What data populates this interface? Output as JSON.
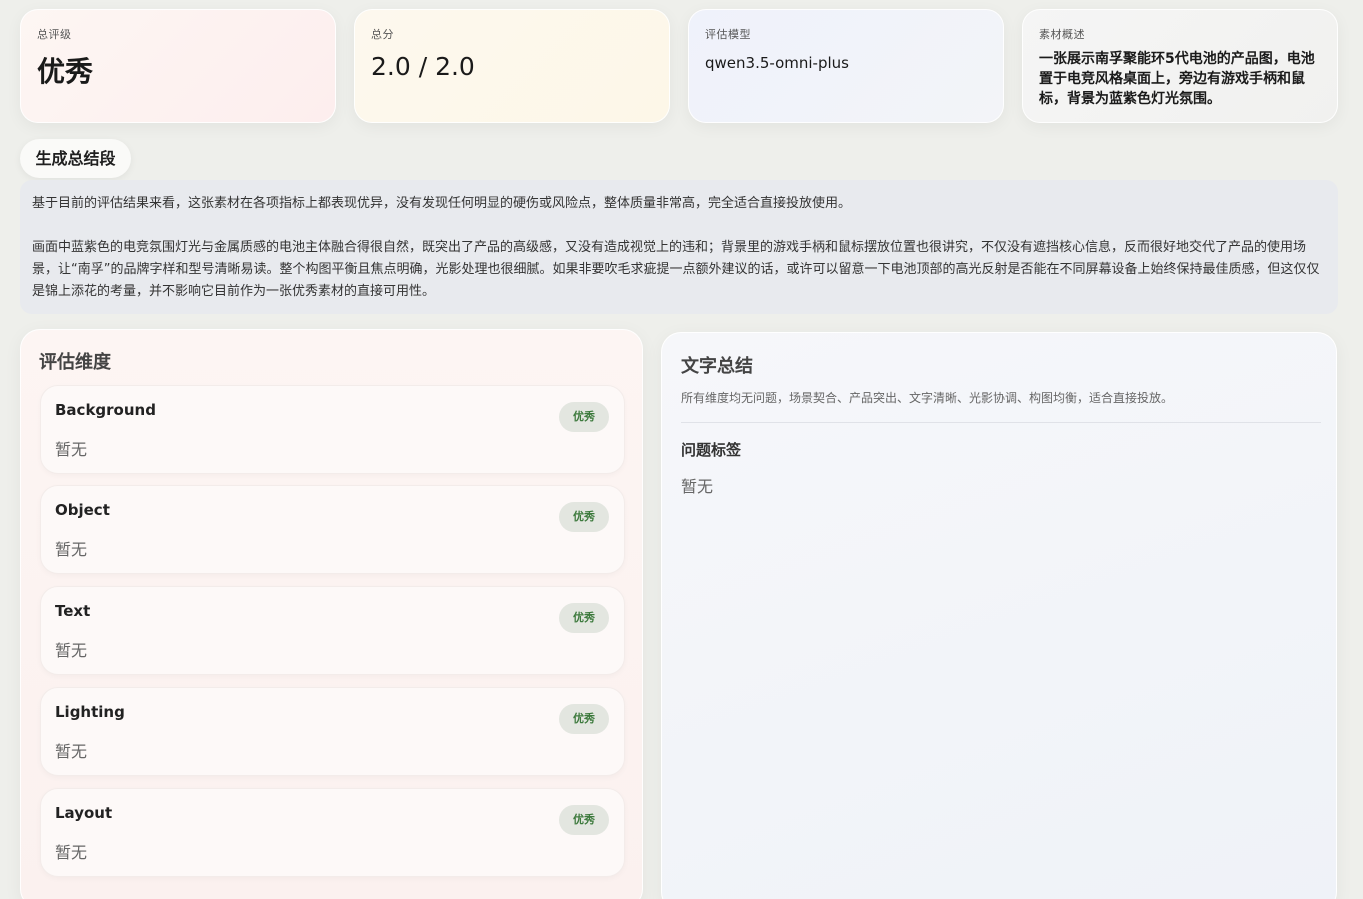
{
  "top_cards": {
    "grade": {
      "label": "总评级",
      "value": "优秀"
    },
    "score": {
      "label": "总分",
      "value": "2.0 / 2.0"
    },
    "model": {
      "label": "评估模型",
      "value": "qwen3.5-omni-plus"
    },
    "description": {
      "label": "素材概述",
      "value": "一张展示南孚聚能环5代电池的产品图，电池置于电竞风格桌面上，旁边有游戏手柄和鼠标，背景为蓝紫色灯光氛围。"
    }
  },
  "summary": {
    "title": "生成总结段",
    "paragraph1": "基于目前的评估结果来看，这张素材在各项指标上都表现优异，没有发现任何明显的硬伤或风险点，整体质量非常高，完全适合直接投放使用。",
    "paragraph2": "画面中蓝紫色的电竞氛围灯光与金属质感的电池主体融合得很自然，既突出了产品的高级感，又没有造成视觉上的违和；背景里的游戏手柄和鼠标摆放位置也很讲究，不仅没有遮挡核心信息，反而很好地交代了产品的使用场景，让“南孚”的品牌字样和型号清晰易读。整个构图平衡且焦点明确，光影处理也很细腻。如果非要吹毛求疵提一点额外建议的话，或许可以留意一下电池顶部的高光反射是否能在不同屏幕设备上始终保持最佳质感，但这仅仅是锦上添花的考量，并不影响它目前作为一张优秀素材的直接可用性。"
  },
  "dimensions": {
    "title": "评估维度",
    "items": [
      {
        "name": "Background",
        "value": "暂无",
        "badge": "优秀"
      },
      {
        "name": "Object",
        "value": "暂无",
        "badge": "优秀"
      },
      {
        "name": "Text",
        "value": "暂无",
        "badge": "优秀"
      },
      {
        "name": "Lighting",
        "value": "暂无",
        "badge": "优秀"
      },
      {
        "name": "Layout",
        "value": "暂无",
        "badge": "优秀"
      }
    ]
  },
  "text_summary": {
    "title": "文字总结",
    "text": "所有维度均无问题，场景契合、产品突出、文字清晰、光影协调、构图均衡，适合直接投放。",
    "tags_title": "问题标签",
    "tags_value": "暂无"
  },
  "colors": {
    "badge_text": "#3d7a3d",
    "badge_bg": "#e3e6e0",
    "page_bg": "#eeefeb"
  }
}
